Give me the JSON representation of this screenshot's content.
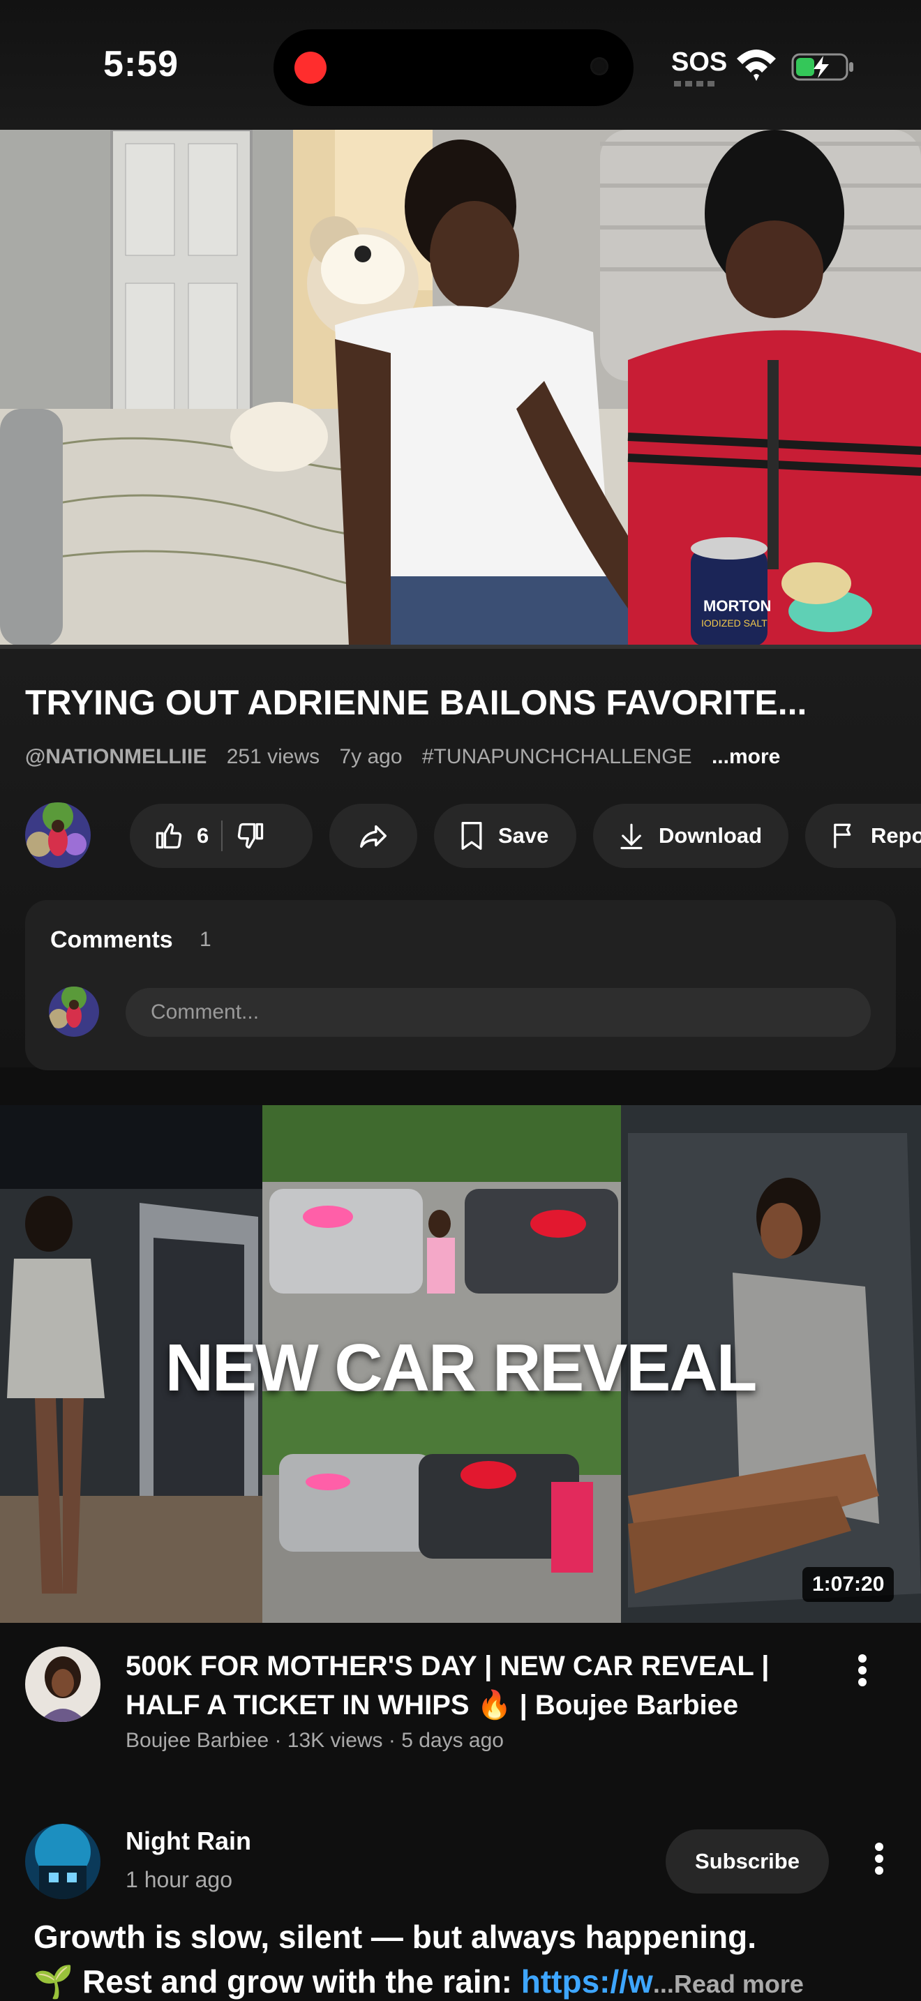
{
  "status_bar": {
    "time": "5:59",
    "sos": "SOS",
    "wifi_icon": "wifi-icon",
    "battery_icon": "battery-charging-icon"
  },
  "player": {
    "progress_fraction": 0.0,
    "scene_labels": {
      "salt_can": "MORTON",
      "salt_can_sub": "IODIZED SALT"
    }
  },
  "video": {
    "title": "TRYING OUT ADRIENNE BAILONS FAVORITE...",
    "channel_handle": "@NATIONMELLIIE",
    "views": "251 views",
    "age": "7y ago",
    "hashtag": "#TUNAPUNCHCHALLENGE",
    "more": "...more"
  },
  "actions": {
    "like_count": "6",
    "save_label": "Save",
    "download_label": "Download",
    "report_label": "Report",
    "icons": [
      "thumbs-up-icon",
      "thumbs-down-icon",
      "share-icon",
      "bookmark-icon",
      "download-icon",
      "flag-icon"
    ]
  },
  "comments": {
    "heading": "Comments",
    "count": "1",
    "placeholder": "Comment..."
  },
  "next_video": {
    "thumbnail_text": "NEW CAR REVEAL",
    "duration": "1:07:20",
    "title": "500K FOR MOTHER'S DAY | NEW CAR REVEAL | HALF A TICKET IN WHIPS 🔥 | Boujee Barbiee",
    "meta": "Boujee Barbiee · 13K views · 5 days ago"
  },
  "post": {
    "author": "Night Rain",
    "time": "1 hour ago",
    "subscribe_label": "Subscribe",
    "line1": "Growth is slow, silent — but always happening.",
    "line2_prefix": "🌱 Rest and grow with the rain: ",
    "link": "https://w",
    "ellipsis": "...",
    "read_more": "Read more"
  },
  "colors": {
    "background": "#0f0f0f",
    "pill": "#272727",
    "link": "#3ea6ff",
    "secondary_text": "#aaaaaa",
    "rec_dot": "#ff2d2d"
  }
}
